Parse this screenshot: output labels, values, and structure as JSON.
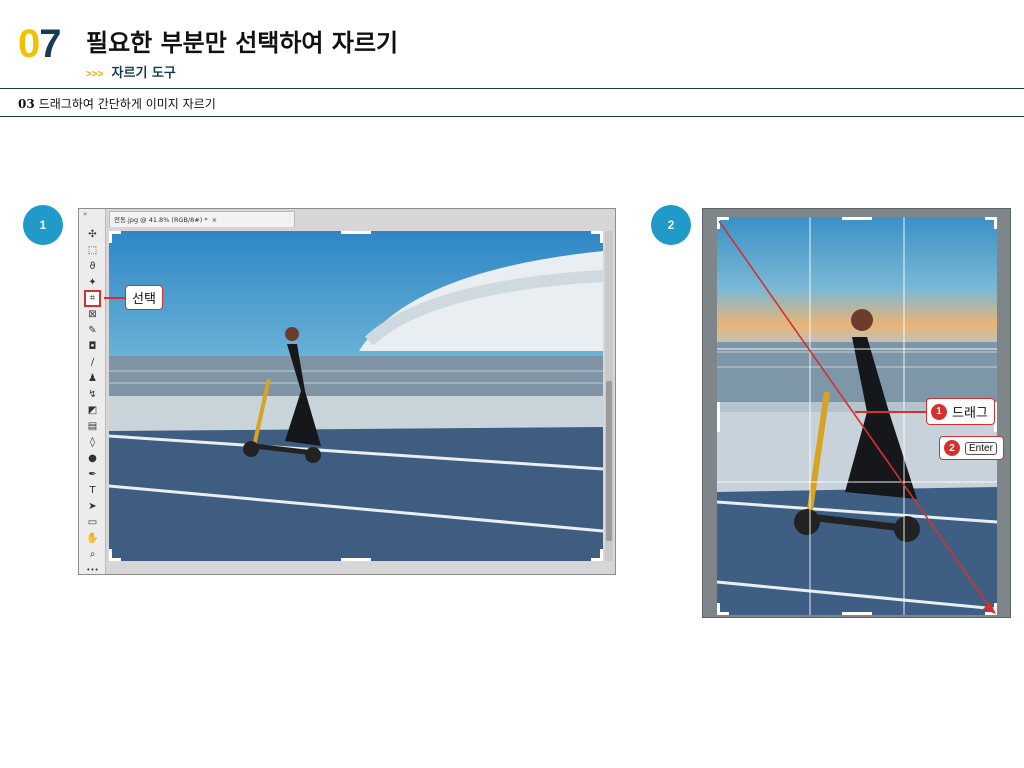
{
  "header": {
    "chapter_digit_0": "0",
    "chapter_digit_7": "7",
    "title": "필요한 부분만 선택하여 자르기",
    "subtitle_arrows": ">>>",
    "subtitle": "자르기 도구"
  },
  "section": {
    "number": "03",
    "title": "드래그하여 간단하게 이미지 자르기"
  },
  "steps": {
    "step1": "1",
    "step2": "2"
  },
  "photoshop": {
    "tab_label": "전동.jpg @ 41.8% (RGB/8#) *",
    "tab_close": "×",
    "callout_select": "선택",
    "tools": [
      {
        "name": "move-tool-icon",
        "glyph": "✣"
      },
      {
        "name": "marquee-tool-icon",
        "glyph": "⬚"
      },
      {
        "name": "lasso-tool-icon",
        "glyph": "ϑ"
      },
      {
        "name": "magic-wand-icon",
        "glyph": "✦"
      },
      {
        "name": "crop-tool-icon",
        "glyph": "⌗"
      },
      {
        "name": "frame-tool-icon",
        "glyph": "⊠"
      },
      {
        "name": "eyedropper-icon",
        "glyph": "✎"
      },
      {
        "name": "healing-brush-icon",
        "glyph": "◘"
      },
      {
        "name": "brush-tool-icon",
        "glyph": "∕"
      },
      {
        "name": "stamp-tool-icon",
        "glyph": "♟"
      },
      {
        "name": "history-brush-icon",
        "glyph": "↯"
      },
      {
        "name": "eraser-icon",
        "glyph": "◩"
      },
      {
        "name": "gradient-icon",
        "glyph": "▤"
      },
      {
        "name": "blur-icon",
        "glyph": "◊"
      },
      {
        "name": "dodge-icon",
        "glyph": "●"
      },
      {
        "name": "pen-tool-icon",
        "glyph": "✒"
      },
      {
        "name": "type-tool-icon",
        "glyph": "T"
      },
      {
        "name": "path-select-icon",
        "glyph": "➤"
      },
      {
        "name": "shape-tool-icon",
        "glyph": "▭"
      },
      {
        "name": "hand-tool-icon",
        "glyph": "✋"
      },
      {
        "name": "zoom-tool-icon",
        "glyph": "⌕"
      },
      {
        "name": "more-tools-icon",
        "glyph": "•••"
      }
    ]
  },
  "crop": {
    "callout_drag_num": "1",
    "callout_drag": "드래그",
    "callout_enter_num": "2",
    "callout_enter_key": "Enter"
  },
  "colors": {
    "accent_red": "#d4312e",
    "badge_blue": "#1f9ac9",
    "navy": "#163c52",
    "yellow": "#f2c200"
  }
}
